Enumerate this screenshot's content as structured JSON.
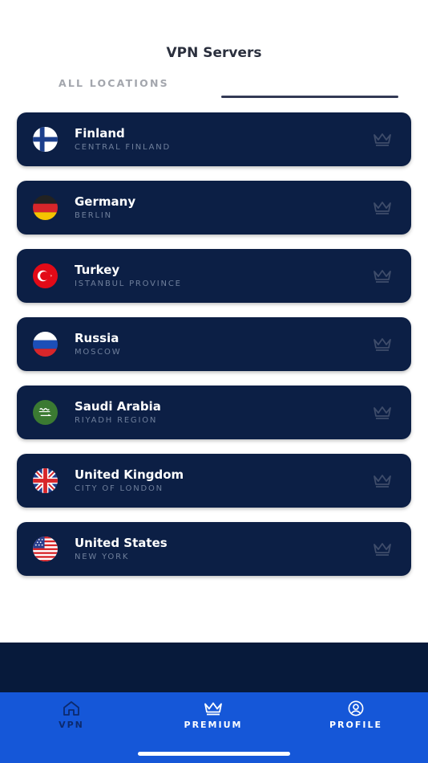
{
  "header": {
    "title": "VPN Servers"
  },
  "tabs": {
    "all_locations": "ALL LOCATIONS"
  },
  "servers": [
    {
      "country": "Finland",
      "region": "CENTRAL FINLAND",
      "flag": "finland-flag-icon"
    },
    {
      "country": "Germany",
      "region": "BERLIN",
      "flag": "germany-flag-icon"
    },
    {
      "country": "Turkey",
      "region": "ISTANBUL PROVINCE",
      "flag": "turkey-flag-icon"
    },
    {
      "country": "Russia",
      "region": "MOSCOW",
      "flag": "russia-flag-icon"
    },
    {
      "country": "Saudi Arabia",
      "region": "RIYADH REGION",
      "flag": "saudi-arabia-flag-icon"
    },
    {
      "country": "United Kingdom",
      "region": "CITY OF LONDON",
      "flag": "uk-flag-icon"
    },
    {
      "country": "United States",
      "region": "NEW YORK",
      "flag": "us-flag-icon"
    }
  ],
  "tabbar": {
    "vpn": "VPN",
    "premium": "PREMIUM",
    "profile": "PROFILE"
  },
  "colors": {
    "card_bg": "#0c1f45",
    "tabbar_bg": "#1557d8",
    "dark_band": "#071a3b",
    "region_text": "#6f7f9b"
  }
}
